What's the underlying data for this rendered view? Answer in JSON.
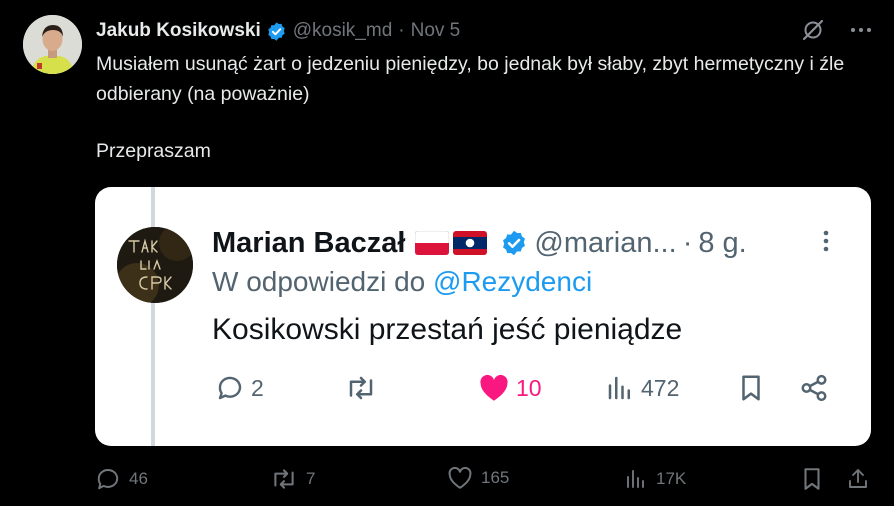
{
  "tweet": {
    "author_name": "Jakub Kosikowski",
    "handle": "@kosik_md",
    "separator": "·",
    "date": "Nov 5",
    "text_line1": "Musiałem usunąć żart o jedzeniu pieniędzy, bo jednak był słaby, zbyt hermetyczny i źle odbierany (na poważnie)",
    "text_line2": "Przepraszam"
  },
  "embedded": {
    "author_name": "Marian Baczał",
    "handle": "@marian...",
    "separator": "·",
    "date": "8 g.",
    "reply_prefix": "W odpowiedzi do",
    "reply_mention": "@Rezydenci",
    "text": "Kosikowski przestań jeść pieniądze",
    "avatar_text": "TAK DLA CPK",
    "stats": {
      "replies": "2",
      "reposts": "",
      "likes": "10",
      "views": "472"
    }
  },
  "actions": {
    "replies": "46",
    "reposts": "7",
    "likes": "165",
    "views": "17K"
  },
  "colors": {
    "verified": "#1d9bf0",
    "like_active": "#f91880",
    "muted": "#71767b"
  },
  "icons": [
    "verified-badge-icon",
    "grok-icon",
    "more-icon",
    "reply-icon",
    "repost-icon",
    "like-icon",
    "views-icon",
    "bookmark-icon",
    "share-icon"
  ]
}
